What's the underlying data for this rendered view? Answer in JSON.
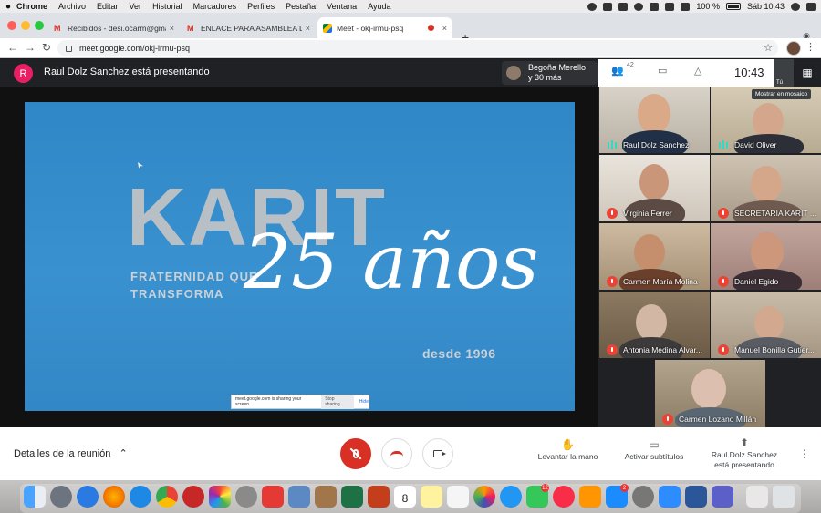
{
  "menubar": {
    "app": "Chrome",
    "items": [
      "Archivo",
      "Editar",
      "Ver",
      "Historial",
      "Marcadores",
      "Perfiles",
      "Pestaña",
      "Ventana",
      "Ayuda"
    ],
    "battery": "100 %",
    "clock": "Sáb 10:43"
  },
  "tabs": [
    {
      "label": "Recibidos - desi.ocarm@gmail",
      "close": "×"
    },
    {
      "label": "ENLACE PARA ASAMBLEA DE K",
      "close": "×"
    },
    {
      "label": "Meet - okj-irmu-psq",
      "close": "×"
    }
  ],
  "address": {
    "url": "meet.google.com/okj-irmu-psq"
  },
  "meet": {
    "presenter_initial": "R",
    "presenting_label": "Raul Dolz Sanchez está presentando",
    "others_line1": "Begoña Merello",
    "others_line2": "y 30 más",
    "participant_count": "42",
    "clock": "10:43",
    "you_label": "Tú",
    "mosaic_tooltip": "Mostrar en mosaico"
  },
  "slide": {
    "brand": "KARIT",
    "tagline_1": "FRATERNIDAD QUE",
    "tagline_2": "TRANSFORMA",
    "anniversary": "25 años",
    "since": "desde 1996"
  },
  "sharebar": {
    "text": "meet.google.com is sharing your screen.",
    "stop": "Stop sharing",
    "hide": "Hide"
  },
  "participants": [
    {
      "name": "Raul Dolz Sanchez",
      "speaking": true
    },
    {
      "name": "David Oliver",
      "speaking": true
    },
    {
      "name": "Virginia Ferrer",
      "speaking": false
    },
    {
      "name": "SECRETARIA KARIT ...",
      "speaking": false
    },
    {
      "name": "Carmen María Molina",
      "speaking": false
    },
    {
      "name": "Daniel Egido",
      "speaking": false
    },
    {
      "name": "Antonia Medina Alvar...",
      "speaking": false
    },
    {
      "name": "Manuel Bonilla Gutier...",
      "speaking": false
    },
    {
      "name": "Carmen Lozano Millán",
      "speaking": false
    }
  ],
  "bottom": {
    "details": "Detalles de la reunión",
    "raise_hand": "Levantar la mano",
    "captions": "Activar subtítulos",
    "presenting_1": "Raul Dolz Sanchez",
    "presenting_2": "está presentando"
  },
  "dock": {
    "badge_facetime": "12",
    "badge_appstore": "2",
    "calendar_month": "MAY",
    "calendar_day": "8"
  }
}
